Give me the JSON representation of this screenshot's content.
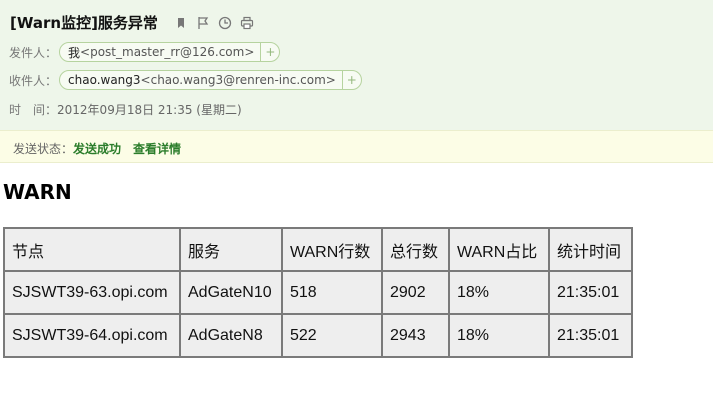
{
  "email": {
    "subject": "[Warn监控]服务异常",
    "sender": {
      "label": "发件人：",
      "name": "我",
      "address": "<post_master_rr@126.com>"
    },
    "recipient": {
      "label": "收件人：",
      "name": "chao.wang3",
      "address": "<chao.wang3@renren-inc.com>"
    },
    "time": {
      "label": "时　间：",
      "value": "2012年09月18日 21:35 (星期二)"
    },
    "status": {
      "label": "发送状态：",
      "value": "发送成功",
      "link": "查看详情"
    }
  },
  "icons": [
    "bookmark-icon",
    "flag-icon",
    "clock-icon",
    "print-icon",
    "add-contact-icon"
  ],
  "content": {
    "title": "WARN",
    "table": {
      "headers": [
        "节点",
        "服务",
        "WARN行数",
        "总行数",
        "WARN占比",
        "统计时间"
      ],
      "rows": [
        [
          "SJSWT39-63.opi.com",
          "AdGateN10",
          "518",
          "2902",
          "18%",
          "21:35:01"
        ],
        [
          "SJSWT39-64.opi.com",
          "AdGateN8",
          "522",
          "2943",
          "18%",
          "21:35:01"
        ]
      ]
    }
  },
  "colors": {
    "header_bg": "#eef6ea",
    "status_bg": "#fcfde6",
    "status_green": "#2b7d2b",
    "table_cell_bg": "#eeeeee",
    "table_border": "#7a7a7a"
  }
}
